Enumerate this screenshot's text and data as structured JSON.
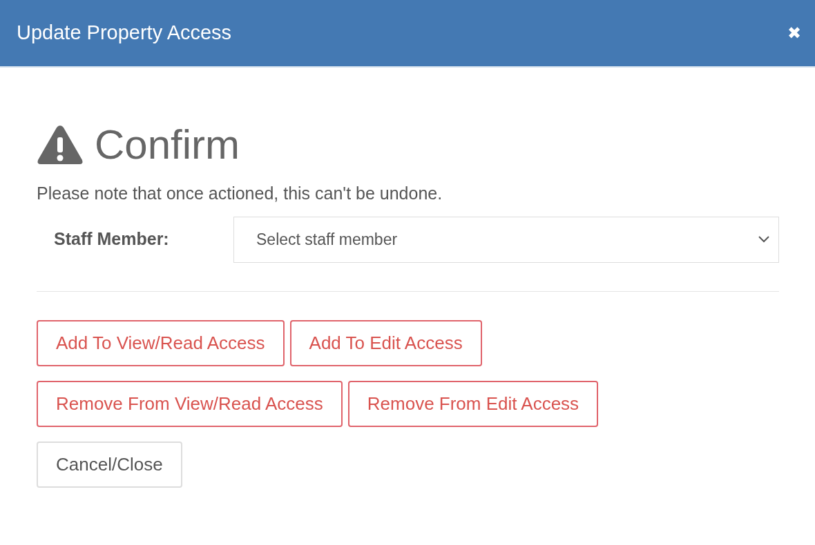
{
  "dialog": {
    "title": "Update Property Access",
    "close": "✖"
  },
  "heading": "Confirm",
  "message": "Please note that once actioned, this can't be undone.",
  "staff_field": {
    "label": "Staff Member:",
    "placeholder": "Select staff member"
  },
  "button_rows": [
    [
      {
        "label": "Add To View/Read Access",
        "kind": "danger"
      },
      {
        "label": "Add To Edit Access",
        "kind": "danger"
      }
    ],
    [
      {
        "label": "Remove From View/Read Access",
        "kind": "danger"
      },
      {
        "label": "Remove From Edit Access",
        "kind": "danger"
      }
    ],
    [
      {
        "label": "Cancel/Close",
        "kind": "default"
      }
    ]
  ]
}
